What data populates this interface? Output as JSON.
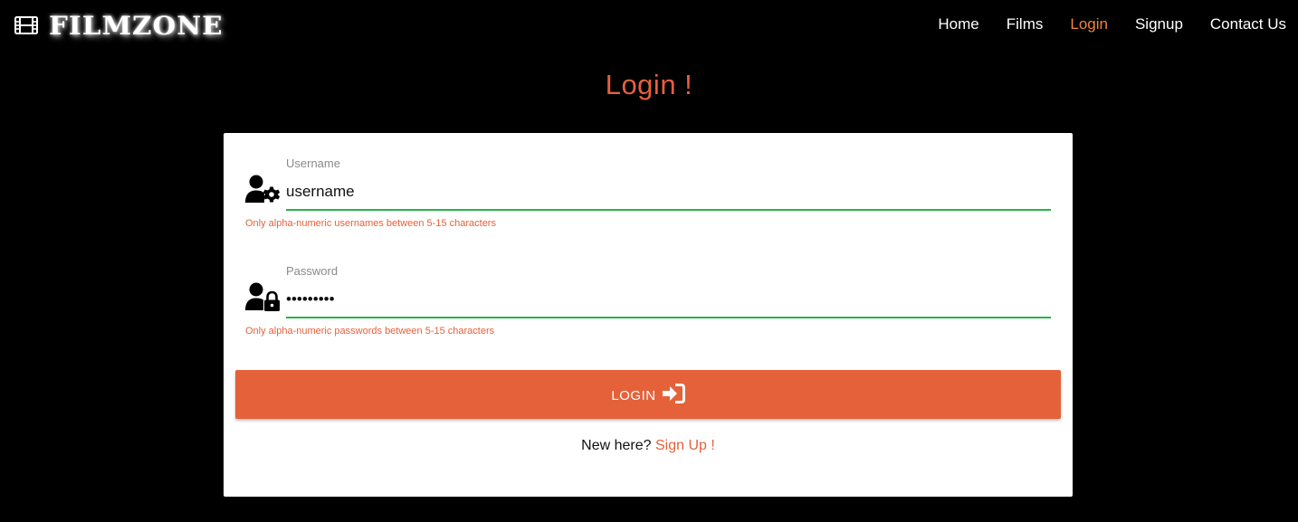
{
  "brand": {
    "name": "FILMZONE",
    "icon": "film-icon"
  },
  "nav": {
    "items": [
      {
        "label": "Home",
        "active": false
      },
      {
        "label": "Films",
        "active": false
      },
      {
        "label": "Login",
        "active": true
      },
      {
        "label": "Signup",
        "active": false
      },
      {
        "label": "Contact Us",
        "active": false
      }
    ]
  },
  "page": {
    "title": "Login !"
  },
  "form": {
    "username": {
      "label": "Username",
      "value": "username",
      "help": "Only alpha-numeric usernames between 5-15 characters",
      "icon": "user-cog-icon"
    },
    "password": {
      "label": "Password",
      "value": "•••••••••",
      "help": "Only alpha-numeric passwords between 5-15 characters",
      "icon": "user-lock-icon"
    },
    "submit": {
      "label": "LOGIN",
      "icon": "sign-in-icon"
    },
    "signup": {
      "prompt": "New here?",
      "link_label": "Sign Up !"
    }
  },
  "colors": {
    "accent": "#e5613a",
    "nav_active": "#f0833a",
    "valid_underline": "#27b34a",
    "background": "#000000"
  }
}
